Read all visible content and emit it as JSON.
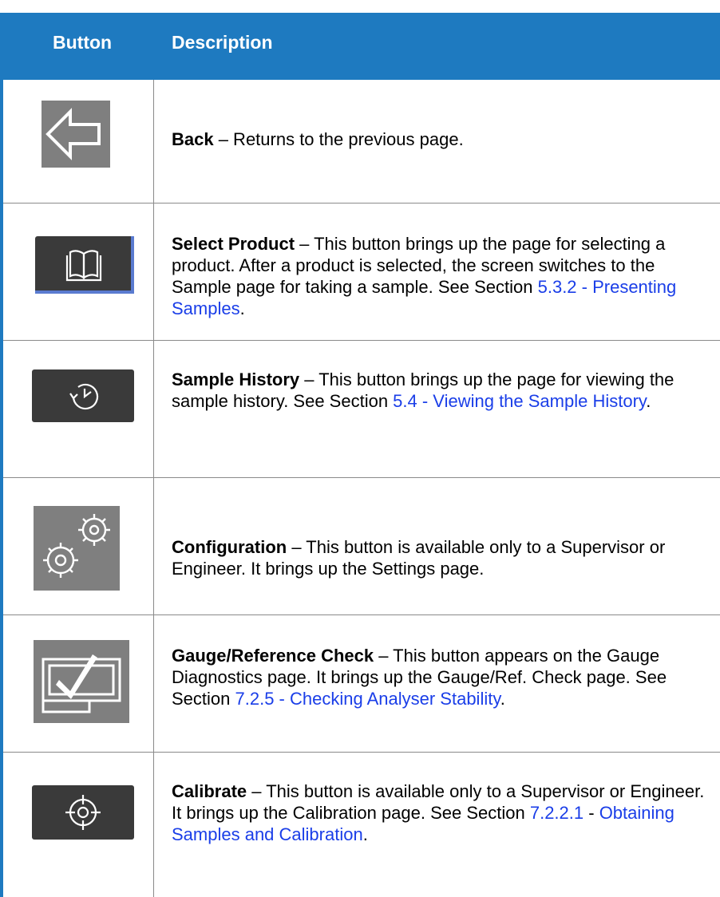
{
  "header": {
    "col_button": "Button",
    "col_description": "Description"
  },
  "rows": [
    {
      "icon": "back-arrow-icon",
      "name": "Back",
      "text": " – Returns to the previous page.",
      "link": "",
      "text_after": ""
    },
    {
      "icon": "open-book-icon",
      "name": "Select Product",
      "text": " – This button brings up the page for selecting a product. After a product is selected, the screen switches to the Sample page for taking a sample. See Section ",
      "link": "5.3.2 - Presenting Samples",
      "text_after": "."
    },
    {
      "icon": "history-clock-icon",
      "name": "Sample History",
      "text": " – This button brings up the page for viewing the sample history. See Section ",
      "link": "5.4 - Viewing the Sample History",
      "text_after": "."
    },
    {
      "icon": "gears-icon",
      "name": "Configuration",
      "text": " – This button is available only to a Supervisor or Engineer. It brings up the Settings page.",
      "link": "",
      "text_after": ""
    },
    {
      "icon": "gauge-check-icon",
      "name": "Gauge/Reference Check",
      "text": " – This button appears on the Gauge Diagnostics page. It brings up the Gauge/Ref. Check page. See Section ",
      "link": "7.2.5 - Checking Analyser Stability",
      "text_after": "."
    },
    {
      "icon": "crosshair-target-icon",
      "name": "Calibrate",
      "text": " – This button is available only to a Supervisor or Engineer. It brings up the Calibration page. See Section ",
      "link_prefix": "7.2.2.1",
      "link_mid": " - ",
      "link": "Obtaining Samples and Calibration",
      "text_after": "."
    }
  ],
  "colors": {
    "header_bg": "#1e7ac0",
    "link": "#1a3ee8",
    "icon_gray": "#7f7f7f",
    "icon_dark": "#3a3a3a"
  }
}
